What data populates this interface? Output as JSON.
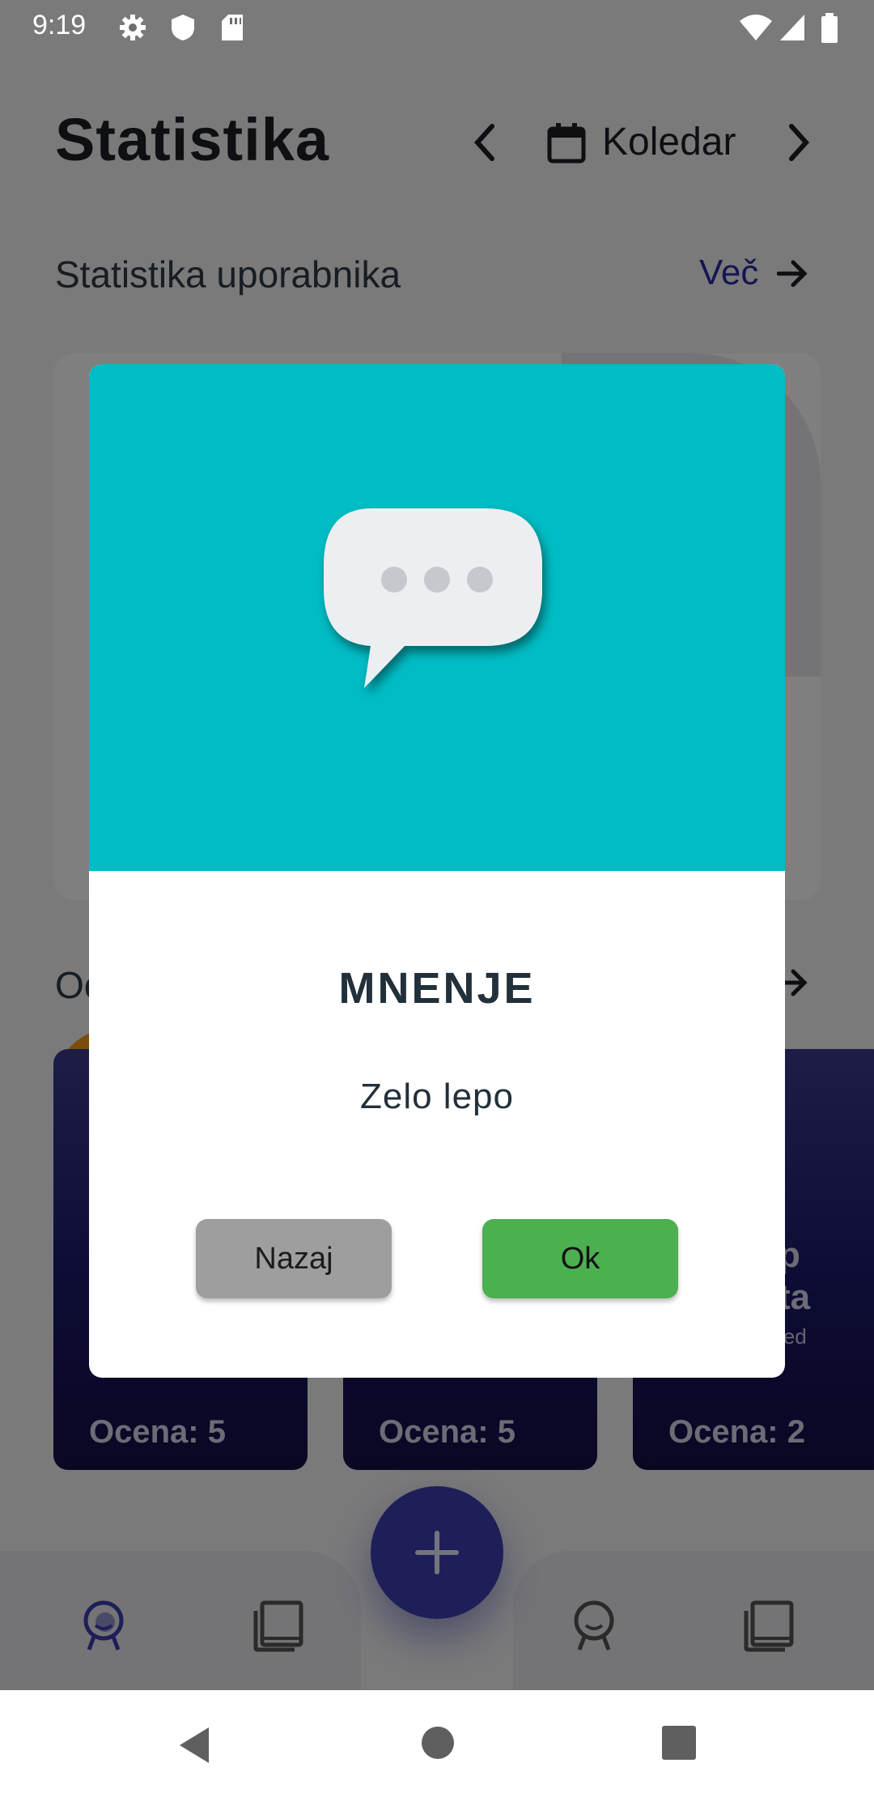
{
  "status_bar": {
    "time": "9:19",
    "left_icons": [
      "gear-icon",
      "shield-icon",
      "sd-card-icon"
    ],
    "right_icons": [
      "wifi-icon",
      "signal-icon",
      "battery-icon"
    ]
  },
  "header": {
    "title": "Statistika",
    "calendar_label": "Koledar"
  },
  "section_user_stats": {
    "title": "Statistika uporabnika",
    "more_label": "Več"
  },
  "section_ratings": {
    "title_visible": "Oc"
  },
  "rating_cards": [
    {
      "label": "Ocena: 5"
    },
    {
      "label": "Ocena: 5"
    },
    {
      "label": "Ocena: 2",
      "partial_line1": "p",
      "partial_line2": "ta",
      "partial_line3": "led"
    }
  ],
  "bottom_nav": {
    "items": [
      "profile-icon",
      "book-icon",
      "profile-icon",
      "book-icon"
    ],
    "fab_icon": "plus-icon"
  },
  "dialog": {
    "icon": "chat-bubble-icon",
    "title": "MNENJE",
    "message": "Zelo lepo",
    "cancel_label": "Nazaj",
    "ok_label": "Ok"
  },
  "colors": {
    "dialog_header": "#00bcc4",
    "ok_button": "#4caf50",
    "cancel_button": "#9e9e9e",
    "accent": "#3d3fb0",
    "link": "#2b2aa8"
  },
  "system_nav": [
    "back-icon",
    "home-icon",
    "recents-icon"
  ]
}
